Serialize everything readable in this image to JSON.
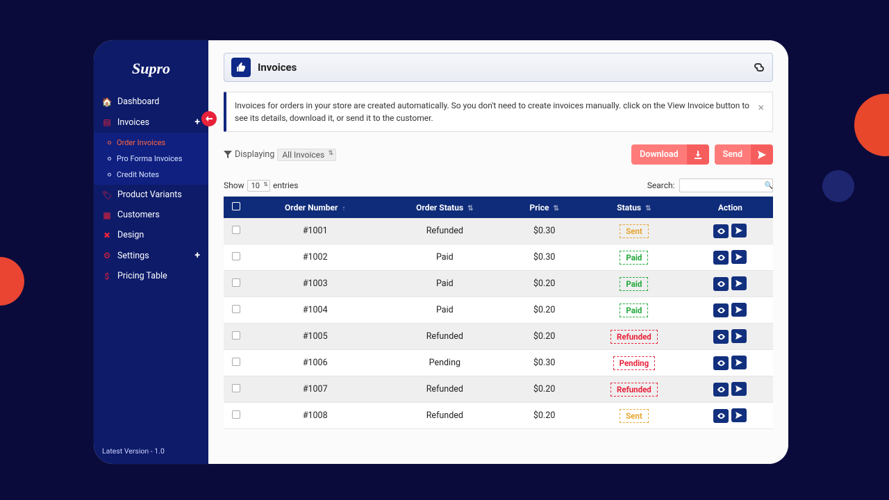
{
  "app": {
    "name": "Supro",
    "version_text": "Latest Version - 1.0"
  },
  "sidebar": {
    "items": [
      {
        "label": "Dashboard",
        "icon": "home"
      },
      {
        "label": "Invoices",
        "icon": "file",
        "expandable": true,
        "sub": [
          {
            "label": "Order Invoices",
            "active": true
          },
          {
            "label": "Pro Forma Invoices"
          },
          {
            "label": "Credit Notes"
          }
        ]
      },
      {
        "label": "Product Variants",
        "icon": "tag"
      },
      {
        "label": "Customers",
        "icon": "grid"
      },
      {
        "label": "Design",
        "icon": "x"
      },
      {
        "label": "Settings",
        "icon": "gear",
        "expandable": true
      },
      {
        "label": "Pricing Table",
        "icon": "dollar"
      }
    ]
  },
  "page": {
    "title": "Invoices",
    "alert": "Invoices for orders in your store are created automatically. So you don't need to create invoices manually. click on the View Invoice button to see its details, download it, or send it to the customer.",
    "filter_label": "Displaying",
    "filter_value": "All Invoices",
    "download_label": "Download",
    "send_label": "Send",
    "show_label": "Show",
    "entries_label": "entries",
    "page_size": "10",
    "search_label": "Search:",
    "columns": {
      "order_number": "Order Number",
      "order_status": "Order Status",
      "price": "Price",
      "status": "Status",
      "action": "Action"
    }
  },
  "invoices": [
    {
      "order_number": "#1001",
      "order_status": "Refunded",
      "price": "$0.30",
      "status": "Sent",
      "status_class": "sent"
    },
    {
      "order_number": "#1002",
      "order_status": "Paid",
      "price": "$0.30",
      "status": "Paid",
      "status_class": "paid"
    },
    {
      "order_number": "#1003",
      "order_status": "Paid",
      "price": "$0.20",
      "status": "Paid",
      "status_class": "paid"
    },
    {
      "order_number": "#1004",
      "order_status": "Paid",
      "price": "$0.20",
      "status": "Paid",
      "status_class": "paid"
    },
    {
      "order_number": "#1005",
      "order_status": "Refunded",
      "price": "$0.20",
      "status": "Refunded",
      "status_class": "refunded"
    },
    {
      "order_number": "#1006",
      "order_status": "Pending",
      "price": "$0.30",
      "status": "Pending",
      "status_class": "pending"
    },
    {
      "order_number": "#1007",
      "order_status": "Refunded",
      "price": "$0.20",
      "status": "Refunded",
      "status_class": "refunded"
    },
    {
      "order_number": "#1008",
      "order_status": "Refunded",
      "price": "$0.20",
      "status": "Sent",
      "status_class": "sent"
    }
  ]
}
